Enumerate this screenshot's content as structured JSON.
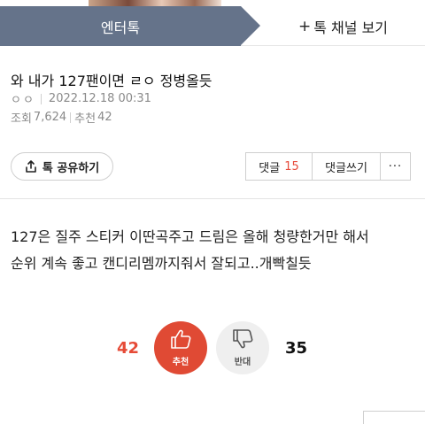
{
  "header": {
    "active_tab": "엔터톡",
    "channel_plus": "+",
    "channel_tab": "톡 채널 보기"
  },
  "post": {
    "title": "와 내가 127팬이면 ㄹㅇ 정병올듯",
    "author": "ㅇㅇ",
    "date": "2022.12.18 00:31",
    "views_label": "조회",
    "views": "7,624",
    "recommend_label": "추천",
    "recommend": "42",
    "body_lines": [
      "127은 질주 스티커 이딴곡주고 드림은 올해 청량한거만 해서",
      "순위 계속 좋고 캔디리멤까지줘서 잘되고..개빡칠듯"
    ]
  },
  "actions": {
    "share_label": "톡 공유하기",
    "comment_label": "댓글",
    "comment_count": "15",
    "write_label": "댓글쓰기",
    "more_label": "···"
  },
  "votes": {
    "up_count": "42",
    "up_label": "추천",
    "down_label": "반대",
    "down_count": "35"
  },
  "colors": {
    "tab_active_bg": "#65738a",
    "accent_red": "#e04a34",
    "comment_count": "#e74c3c"
  },
  "icons": [
    "share-icon",
    "thumbs-up-icon",
    "thumbs-down-icon",
    "more-icon"
  ]
}
